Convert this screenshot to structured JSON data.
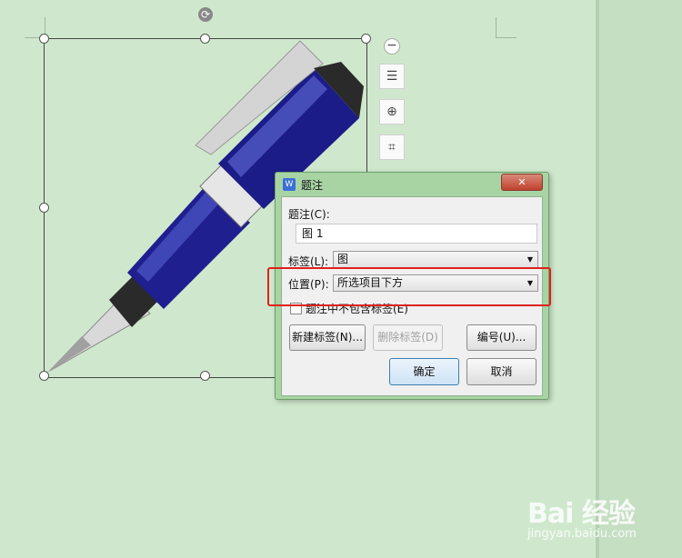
{
  "toolbar": {
    "collapse_icon": "minus-circle-icon",
    "wrap_icon": "text-wrap-icon",
    "zoom_icon": "zoom-in-icon",
    "crop_icon": "crop-icon",
    "rotate_icon": "rotate-icon"
  },
  "dialog": {
    "title": "题注",
    "close_label": "✕",
    "caption_label": "题注(C):",
    "caption_value": "图 1",
    "label_label": "标签(L):",
    "label_value": "图",
    "position_label": "位置(P):",
    "position_value": "所选项目下方",
    "exclude_label_text": "题注中不包含标签(E)",
    "exclude_label_checked": false,
    "new_label_button": "新建标签(N)...",
    "delete_label_button": "删除标签(D)",
    "numbering_button": "编号(U)...",
    "ok_button": "确定",
    "cancel_button": "取消"
  },
  "colors": {
    "page_background": "#cfe8cd",
    "highlight": "#e0201c",
    "pen_body": "#1f1f8f"
  },
  "watermark": {
    "logo": "Bai 经验",
    "site": "jingyan.baidu.com"
  }
}
